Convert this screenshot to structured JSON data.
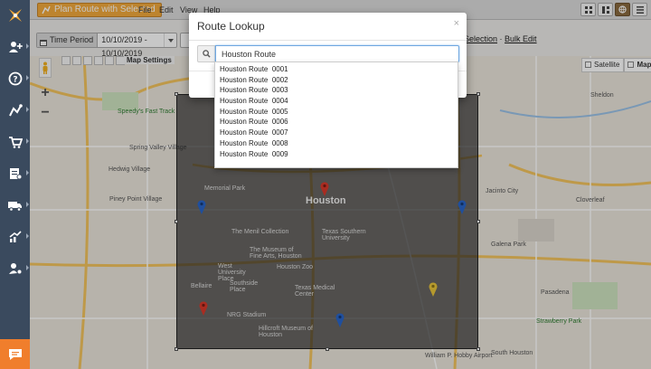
{
  "topbar": {
    "plan_button": "Plan Route with Selected",
    "menu": [
      "File",
      "Edit",
      "View",
      "Help"
    ]
  },
  "toolbar": {
    "time_period_label": "Time Period",
    "time_period_value": "10/10/2019 - 10/10/2019",
    "selection_link": "Selection",
    "bulk_edit_link": "Bulk Edit"
  },
  "map": {
    "settings_label": "Map Settings",
    "maptypes": [
      "Satellite",
      "Map"
    ],
    "selected_maptype": "Map",
    "city_label": "Houston",
    "labels": [
      "Speedy's Fast Track",
      "Spring Valley Village",
      "Hedwig Village",
      "Piney Point Village",
      "Memorial Park",
      "The Menil Collection",
      "The Museum of Fine Arts, Houston",
      "West University Place",
      "Bellaire",
      "Southside Place",
      "Houston Zoo",
      "Texas Medical Center",
      "NRG Stadium",
      "Hillcroft Museum of Houston",
      "Jacinto City",
      "Cloverleaf",
      "Galena Park",
      "Pasadena",
      "Strawberry Park",
      "South Houston",
      "William P. Hobby Airport",
      "Sheldon",
      "Texas Southern University"
    ]
  },
  "modal": {
    "title": "Route Lookup",
    "close": "×",
    "search_value": "Houston Route",
    "results": [
      "Houston Route  0001",
      "Houston Route  0002",
      "Houston Route  0003",
      "Houston Route  0004",
      "Houston Route  0005",
      "Houston Route  0006",
      "Houston Route  0007",
      "Houston Route  0008",
      "Houston Route  0009"
    ]
  },
  "colors": {
    "sidebar": "#3a4a5e",
    "accent": "#f2a93b",
    "chat": "#f07e2c",
    "pin_red": "#d9392b",
    "pin_blue": "#2a66c9",
    "pin_yellow": "#e8c53a"
  }
}
